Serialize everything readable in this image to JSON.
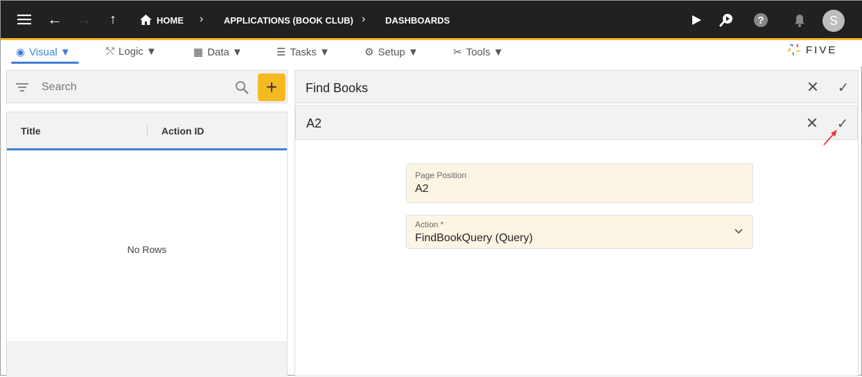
{
  "topbar": {
    "breadcrumbs": [
      "HOME",
      "APPLICATIONS (BOOK CLUB)",
      "DASHBOARDS"
    ],
    "avatar": "S",
    "accent": "#f5b921"
  },
  "menu": {
    "items": [
      {
        "label": "Visual ▼",
        "icon": "eye-icon"
      },
      {
        "label": "Logic ▼",
        "icon": "logic-icon"
      },
      {
        "label": "Data ▼",
        "icon": "table-icon"
      },
      {
        "label": "Tasks ▼",
        "icon": "checklist-icon"
      },
      {
        "label": "Setup ▼",
        "icon": "gear-icon"
      },
      {
        "label": "Tools ▼",
        "icon": "tools-icon"
      }
    ],
    "logo": "FIVE"
  },
  "left": {
    "search_placeholder": "Search",
    "columns": [
      "Title",
      "Action ID"
    ],
    "empty": "No Rows"
  },
  "right": {
    "title": "Find Books",
    "subtitle": "A2",
    "fields": [
      {
        "label": "Page Position",
        "value": "A2"
      },
      {
        "label": "Action *",
        "value": "FindBookQuery (Query)"
      }
    ]
  }
}
